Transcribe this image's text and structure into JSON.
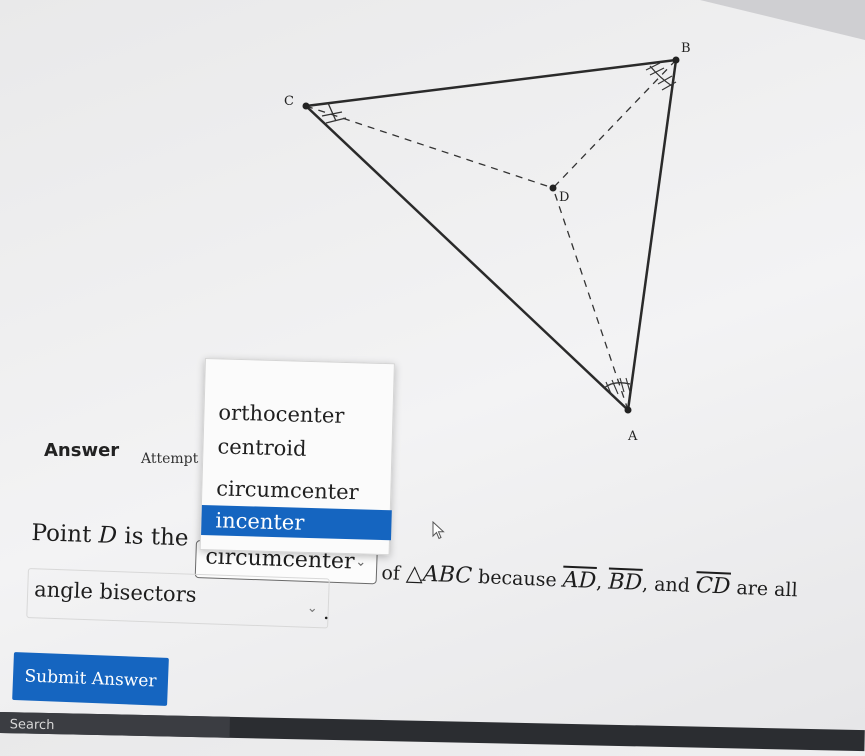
{
  "diagram": {
    "points": {
      "a": "A",
      "b": "B",
      "c": "C",
      "d": "D"
    }
  },
  "answer": {
    "label": "Answer",
    "attempt": "Attempt"
  },
  "dropdown": {
    "options": [
      "orthocenter",
      "centroid",
      "circumcenter",
      "incenter"
    ],
    "highlighted": "incenter"
  },
  "question": {
    "prefix_point": "Point",
    "point": "D",
    "is_the": "is the",
    "select1_value": "circumcenter",
    "of": "of",
    "triangle": "△ABC",
    "because": "because",
    "seg_ad": "AD",
    "seg_bd": "BD",
    "and": "and",
    "seg_cd": "CD",
    "are_all": "are all",
    "select2_value": "angle bisectors",
    "period": "."
  },
  "submit": {
    "label": "Submit Answer"
  },
  "taskbar": {
    "search": "Search"
  },
  "colors": {
    "accent": "#1565c0"
  }
}
